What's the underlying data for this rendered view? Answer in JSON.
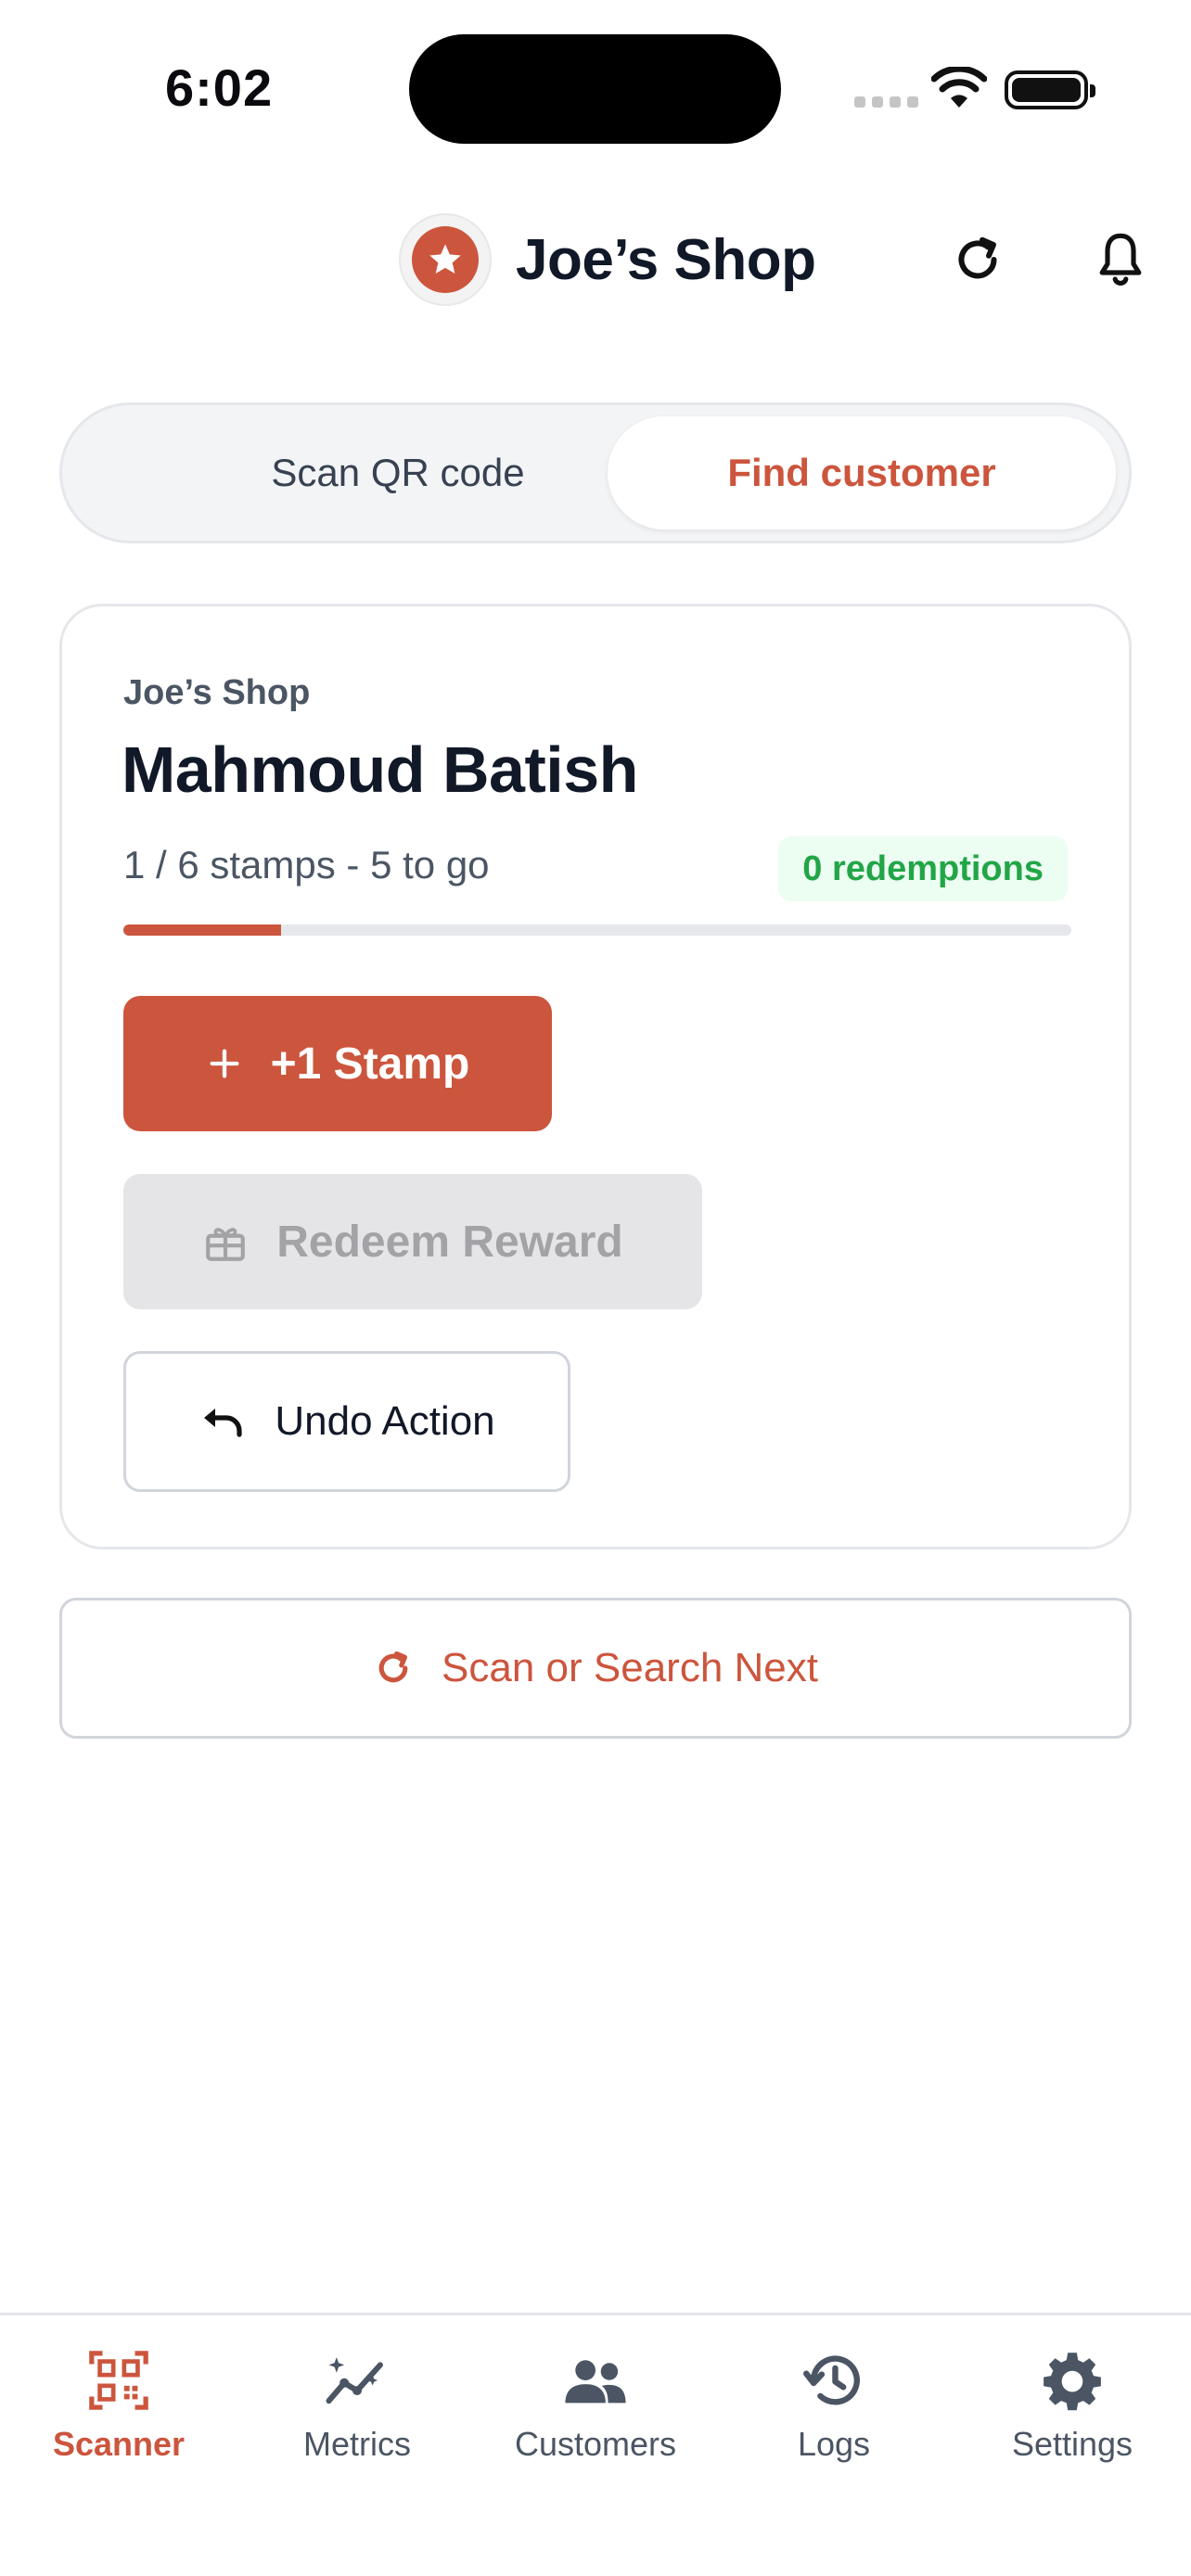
{
  "status_bar": {
    "time": "6:02"
  },
  "header": {
    "shop_name": "Joe’s Shop",
    "logo_icon": "star-icon"
  },
  "segment": {
    "scan_label": "Scan QR code",
    "find_label": "Find customer",
    "selected": "find"
  },
  "card": {
    "shop_name": "Joe’s Shop",
    "customer_name": "Mahmoud Batish",
    "progress_text": "1 / 6 stamps - 5 to go",
    "progress_fraction": 0.1667,
    "redemptions_label": "0 redemptions",
    "stamp_button": "+1 Stamp",
    "redeem_button": "Redeem Reward",
    "undo_button": "Undo Action"
  },
  "next_button": "Scan or Search Next",
  "nav": {
    "items": [
      {
        "label": "Scanner",
        "icon": "qr-scanner-icon",
        "active": true
      },
      {
        "label": "Metrics",
        "icon": "metrics-icon",
        "active": false
      },
      {
        "label": "Customers",
        "icon": "customers-icon",
        "active": false
      },
      {
        "label": "Logs",
        "icon": "history-icon",
        "active": false
      },
      {
        "label": "Settings",
        "icon": "gear-icon",
        "active": false
      }
    ]
  },
  "colors": {
    "accent": "#cc553d",
    "success": "#22a547",
    "text": "#111827",
    "muted": "#4b5563"
  }
}
